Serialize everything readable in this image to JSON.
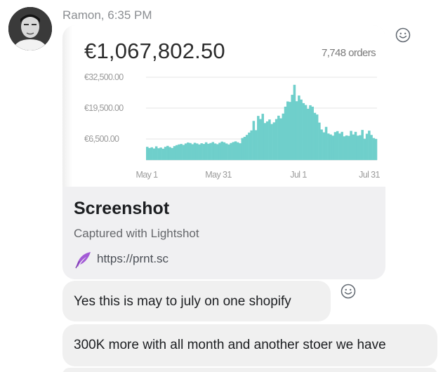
{
  "message": {
    "sender": "Ramon",
    "time": "6:35 PM",
    "sender_line": "Ramon, 6:35 PM"
  },
  "link_preview": {
    "title": "Screenshot",
    "subtitle": "Captured with Lightshot",
    "url": "https://prnt.sc",
    "icon": "feather-icon"
  },
  "screenshot": {
    "total": "€1,067,802.50",
    "orders": "7,748 orders"
  },
  "chart_data": {
    "type": "area",
    "x_tick_labels": [
      "May 1",
      "May 31",
      "Jul 1",
      "Jul 31"
    ],
    "y_tick_labels": [
      "€32,500.00",
      "€19,500.00",
      "€6,500.00"
    ],
    "y_ticks": [
      32500,
      19500,
      6500
    ],
    "ylim": [
      0,
      36000
    ],
    "series_color": "#6fcfcb",
    "grid": true,
    "values": [
      3200,
      2700,
      3000,
      2500,
      3400,
      2600,
      2900,
      2400,
      3200,
      3600,
      3100,
      2700,
      3500,
      3900,
      4200,
      4400,
      4000,
      4600,
      5000,
      4800,
      4300,
      4900,
      4600,
      4200,
      4700,
      4400,
      5100,
      4500,
      4800,
      5200,
      4600,
      4300,
      4900,
      5400,
      5100,
      4600,
      4200,
      4800,
      5200,
      5500,
      5100,
      4700,
      6900,
      7400,
      8200,
      9200,
      10100,
      14100,
      10200,
      16200,
      14900,
      17100,
      13200,
      13900,
      14700,
      12800,
      13500,
      14900,
      16300,
      15200,
      17200,
      20100,
      22300,
      22100,
      25100,
      29300,
      22400,
      24800,
      23100,
      21600,
      20800,
      19200,
      20700,
      20100,
      17500,
      16800,
      13400,
      10500,
      9300,
      11600,
      8800,
      8400,
      7900,
      9400,
      9800,
      8800,
      9500,
      7600,
      8000,
      7800,
      9900,
      8400,
      9500,
      7900,
      8100,
      10300,
      6600,
      8700,
      10000,
      8200,
      6900,
      6500
    ]
  },
  "reactions": {
    "icon": "smiley-icon"
  },
  "messages": [
    {
      "text": "Yes this is may to july on one shopify"
    },
    {
      "text": "300K more with all month and another stoer we have"
    }
  ]
}
